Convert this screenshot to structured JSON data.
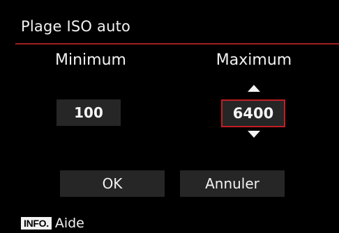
{
  "screen": {
    "title": "Plage ISO auto",
    "accent_color": "#c21d24"
  },
  "columns": {
    "minimum_label": "Minimum",
    "maximum_label": "Maximum"
  },
  "values": {
    "minimum": "100",
    "maximum": "6400",
    "maximum_selected": true,
    "maximum_up_icon": "arrow-up-icon",
    "maximum_down_icon": "arrow-down-icon"
  },
  "buttons": {
    "ok_label": "OK",
    "cancel_label": "Annuler"
  },
  "footer": {
    "info_badge": "INFO.",
    "help_label": "Aide"
  }
}
